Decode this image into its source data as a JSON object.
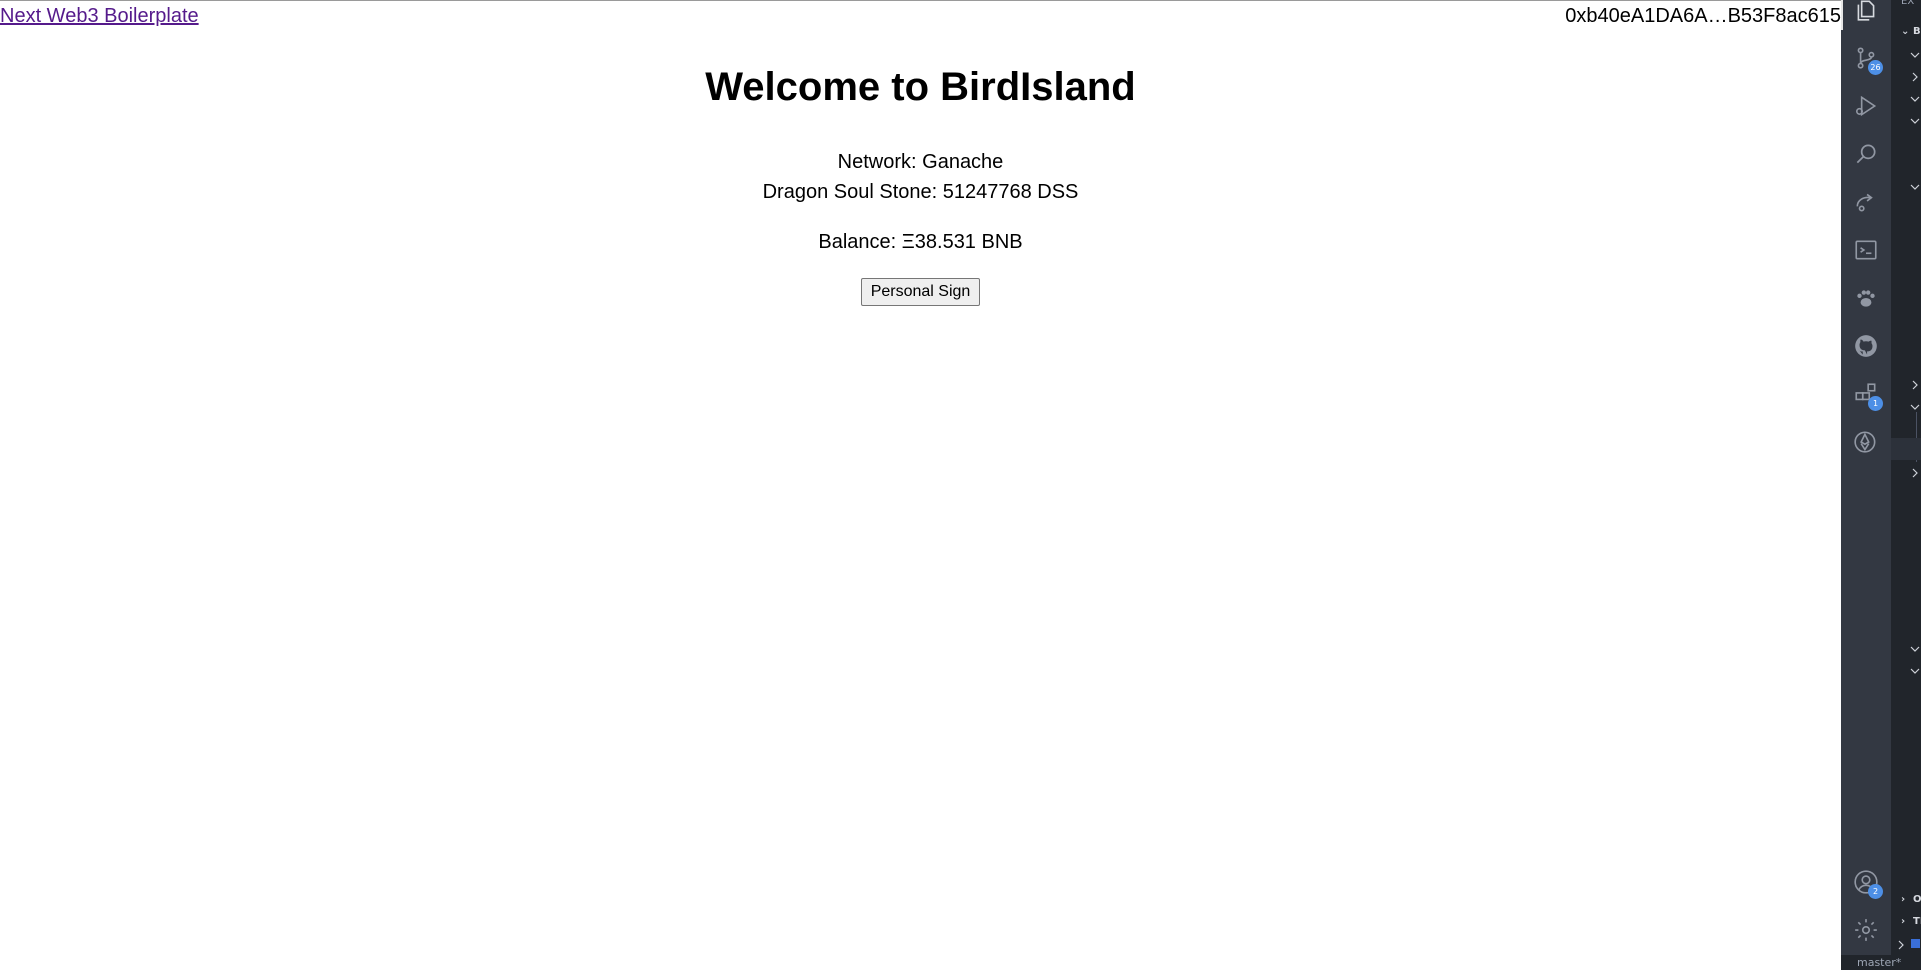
{
  "page": {
    "top_link": "Next Web3 Boilerplate",
    "account_address": "0xb40eA1DA6A…B53F8ac615",
    "heading": "Welcome to BirdIsland",
    "network_line": "Network: Ganache",
    "token_line": "Dragon Soul Stone: 51247768 DSS",
    "balance_line": "Balance: Ξ38.531 BNB",
    "sign_button": "Personal Sign"
  },
  "vscode": {
    "activity_bar": [
      {
        "icon": "explorer-icon",
        "active": true
      },
      {
        "icon": "source-control-icon",
        "badge": "26"
      },
      {
        "icon": "run-debug-icon"
      },
      {
        "icon": "search-icon"
      },
      {
        "icon": "remote-explorer-icon"
      },
      {
        "icon": "terminal-icon"
      },
      {
        "icon": "paw-icon"
      },
      {
        "icon": "github-icon"
      },
      {
        "icon": "extensions-icon",
        "badge": "1"
      },
      {
        "icon": "ethereum-icon"
      },
      {
        "icon": "accounts-icon",
        "badge": "2"
      },
      {
        "icon": "settings-gear-icon"
      }
    ],
    "side_panel": {
      "top_label": "EX",
      "section_header": "BI",
      "outline_header": "OU",
      "timeline_header": "TI"
    },
    "status_bar": {
      "branch": "master*"
    },
    "colors": {
      "activity_bg": "#333842",
      "sidebar_bg": "#21252b",
      "badge": "#4d8fe6"
    }
  }
}
